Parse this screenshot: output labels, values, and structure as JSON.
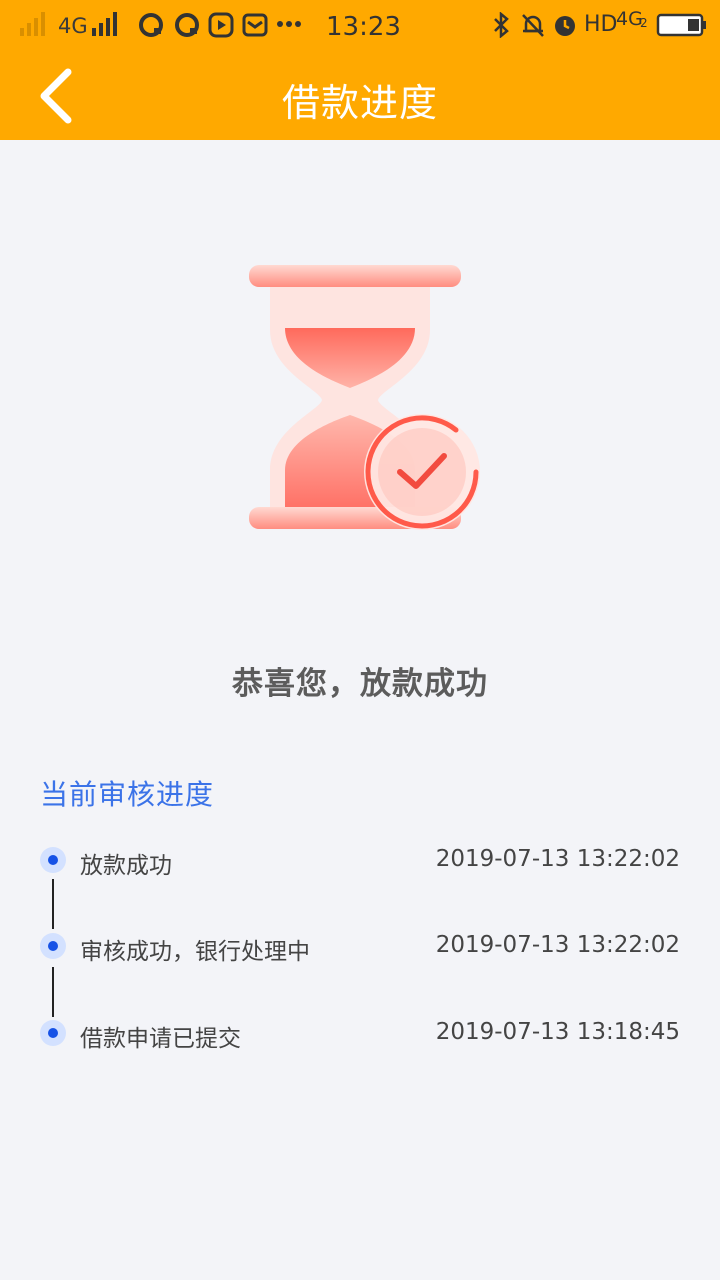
{
  "status_bar": {
    "network": "4G",
    "time": "13:23",
    "hd": "HD",
    "network2": "4G",
    "network2_sub": "2"
  },
  "nav": {
    "title": "借款进度"
  },
  "result": {
    "message": "恭喜您，放款成功"
  },
  "progress": {
    "section_title": "当前审核进度",
    "items": [
      {
        "label": "放款成功",
        "time": "2019-07-13 13:22:02"
      },
      {
        "label": "审核成功，银行处理中",
        "time": "2019-07-13 13:22:02"
      },
      {
        "label": "借款申请已提交",
        "time": "2019-07-13 13:18:45"
      }
    ]
  },
  "colors": {
    "header": "#ffa900",
    "accent_blue": "#3b73e8",
    "dot": "#1652e6",
    "background": "#f3f4f8"
  }
}
